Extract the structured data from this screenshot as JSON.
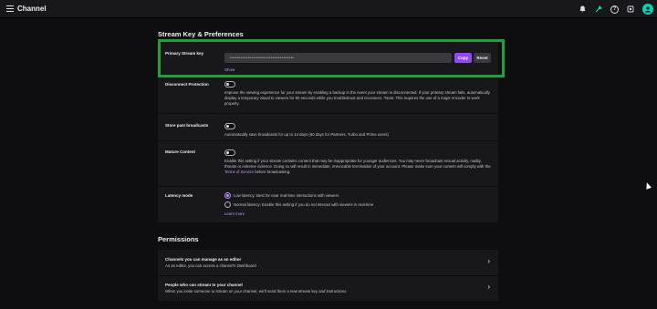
{
  "header": {
    "title": "Channel",
    "icons": [
      "menu-icon",
      "notifications-icon",
      "extensions-icon",
      "help-icon",
      "settings-icon",
      "avatar"
    ],
    "help_glyph": "?"
  },
  "stream_key_section": {
    "title": "Stream Key & Preferences",
    "primary_key": {
      "label": "Primary Stream key",
      "value": "••••••••••••••••••••••••••••••••••••",
      "copy_label": "Copy",
      "reset_label": "Reset",
      "show_label": "Show"
    },
    "disconnect_protection": {
      "label": "Disconnect Protection",
      "enabled": false,
      "description": "Improve the viewing experience for your stream by enabling a backup in the event your stream is disconnected. If your primary stream fails, automatically display a temporary visual to viewers for 90 seconds while you troubleshoot and reconnect. *Note: This requires the use of a major encoder to work properly."
    },
    "store_past_broadcasts": {
      "label": "Store past broadcasts",
      "enabled": false,
      "description": "Automatically save broadcasts for up to 14 days (60 days for Partners, Turbo and Prime users)"
    },
    "mature_content": {
      "label": "Mature Content",
      "enabled": false,
      "description_pre": "Enable this setting if your stream contains content that may be inappropriate for younger audiences. You may never broadcast sexual activity, nudity, threats or extreme violence. Doing so will result in immediate, irrevocable termination of your account. Please make sure your content will comply with the ",
      "terms_link": "Terms of Service",
      "description_post": " before broadcasting."
    },
    "latency_mode": {
      "label": "Latency mode",
      "options": [
        {
          "label": "Low latency: Best for near real-time interactions with viewers",
          "selected": true
        },
        {
          "label": "Normal latency: Enable this setting if you do not interact with viewers in real-time",
          "selected": false
        }
      ],
      "learn_more": "Learn more"
    }
  },
  "permissions_section": {
    "title": "Permissions",
    "items": [
      {
        "title": "Channels you can manage as an editor",
        "subtitle": "As an editor, you can access a channel's Dashboard"
      },
      {
        "title": "People who can stream to your channel",
        "subtitle": "When you invite someone to stream on your channel, we'll send them a new stream key and instructions"
      }
    ]
  },
  "colors": {
    "background": "#0e0e10",
    "card": "#18181b",
    "accent": "#9147ff",
    "link": "#bf94ff",
    "highlight_box": "#1aa33a",
    "avatar": "#00d6b4"
  }
}
